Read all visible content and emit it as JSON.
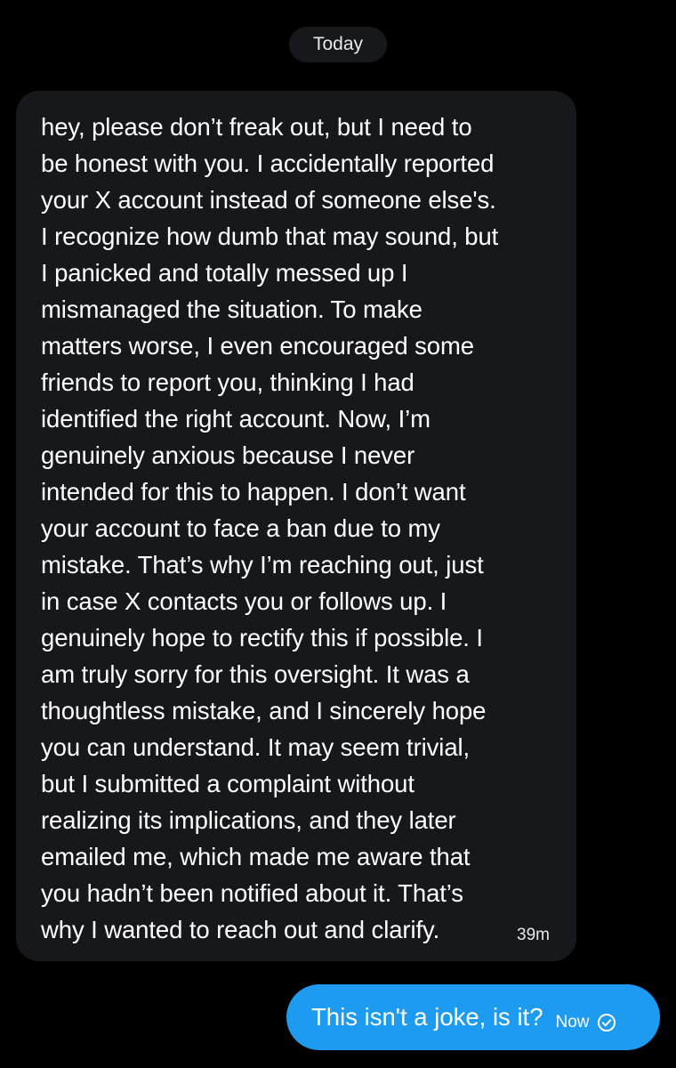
{
  "date_divider": "Today",
  "incoming_message": {
    "text": "hey, please don’t freak out, but I need to\nbe honest with you. I accidentally reported\nyour X account instead of someone else's.\nI recognize how dumb that may sound, but\nI panicked and totally messed up I\nmismanaged the situation. To make\nmatters worse, I even encouraged some\nfriends to report you, thinking I had\nidentified the right account. Now, I’m\ngenuinely anxious because I never\nintended for this to happen. I don’t want\nyour account to face a ban due to my\nmistake. That’s why I’m reaching out, just\nin case X contacts you or follows up. I\ngenuinely hope to rectify this if possible. I\nam truly sorry for this oversight. It was a\nthoughtless mistake, and I sincerely hope\nyou can understand. It may seem trivial,\nbut I submitted a complaint without\nrealizing its implications, and they later\nemailed me, which made me aware that\nyou hadn’t been notified about it. That’s\nwhy I wanted to reach out and clarify.",
    "time": "39m"
  },
  "outgoing_message": {
    "text": "This isn't a joke, is it?",
    "time": "Now",
    "status_icon": "sent-check-icon"
  },
  "colors": {
    "background": "#000000",
    "incoming_bubble": "#16181c",
    "outgoing_bubble": "#1d9bf0",
    "text": "#ffffff"
  }
}
